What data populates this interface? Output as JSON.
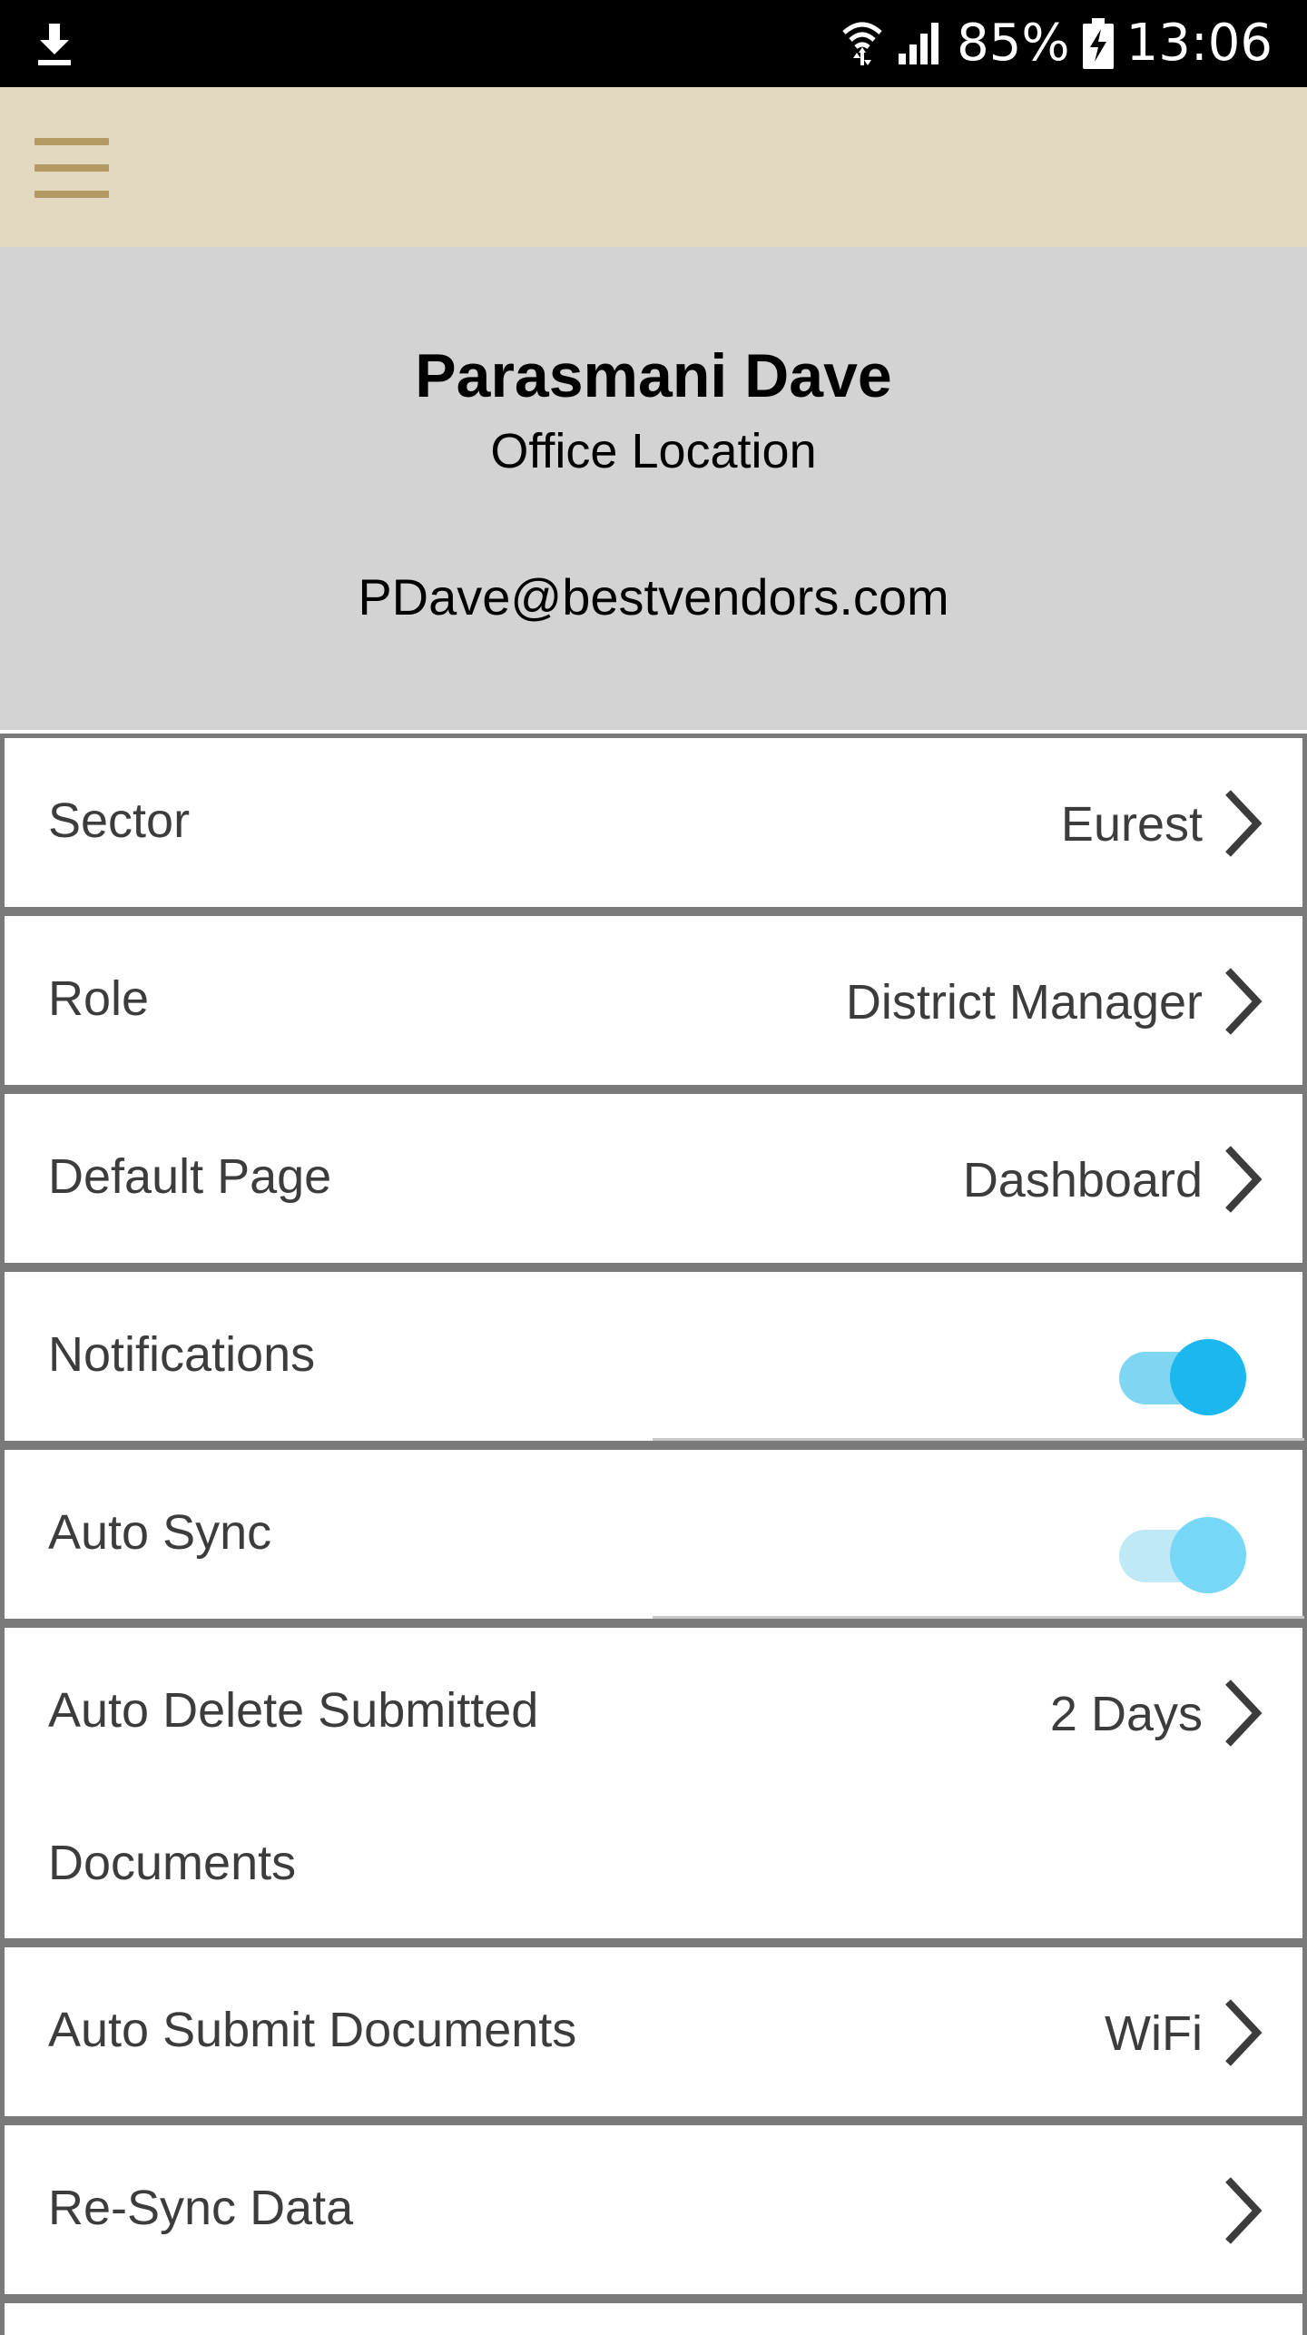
{
  "status_bar": {
    "battery": "85%",
    "time": "13:06",
    "icons": [
      "download-icon",
      "wifi-icon",
      "signal-icon",
      "battery-charging-icon"
    ]
  },
  "app_bar": {
    "menu_icon": "hamburger-menu-icon",
    "background": "#e3d9c1",
    "accent": "#b39a62"
  },
  "profile": {
    "name": "Parasmani Dave",
    "location": "Office Location",
    "email": "PDave@bestvendors.com"
  },
  "settings": {
    "sector": {
      "label": "Sector",
      "value": "Eurest"
    },
    "role": {
      "label": "Role",
      "value": "District Manager"
    },
    "default_page": {
      "label": "Default Page",
      "value": "Dashboard"
    },
    "notifications": {
      "label": "Notifications",
      "enabled": true,
      "track_color": "#7fd6f2",
      "thumb_color": "#1ab8ee"
    },
    "auto_sync": {
      "label": "Auto Sync",
      "enabled": true,
      "track_color": "#bfe9f7",
      "thumb_color": "#76d8f6"
    },
    "auto_delete": {
      "label_line1": "Auto Delete Submitted",
      "label_line2": "Documents",
      "value": "2 Days"
    },
    "auto_submit": {
      "label": "Auto Submit Documents",
      "value": "WiFi"
    },
    "resync": {
      "label": "Re-Sync Data"
    }
  }
}
